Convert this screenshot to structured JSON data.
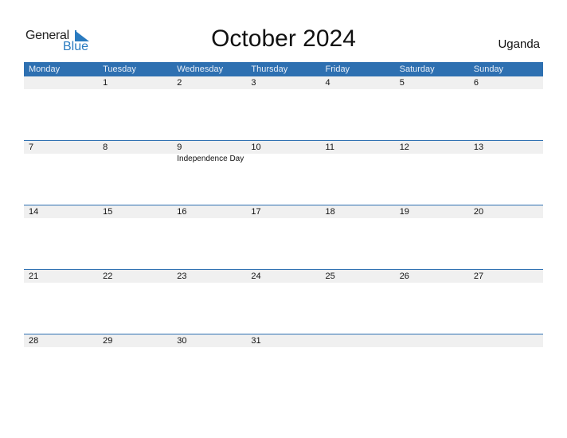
{
  "logo": {
    "word1": "General",
    "word2": "Blue"
  },
  "title": "October 2024",
  "country": "Uganda",
  "colors": {
    "accent": "#2e70b1",
    "strip": "#f0f0f0",
    "logo_blue": "#2a7bc0"
  },
  "weekdays": [
    "Monday",
    "Tuesday",
    "Wednesday",
    "Thursday",
    "Friday",
    "Saturday",
    "Sunday"
  ],
  "weeks": [
    [
      {
        "d": ""
      },
      {
        "d": "1"
      },
      {
        "d": "2"
      },
      {
        "d": "3"
      },
      {
        "d": "4"
      },
      {
        "d": "5"
      },
      {
        "d": "6"
      }
    ],
    [
      {
        "d": "7"
      },
      {
        "d": "8"
      },
      {
        "d": "9",
        "event": "Independence Day"
      },
      {
        "d": "10"
      },
      {
        "d": "11"
      },
      {
        "d": "12"
      },
      {
        "d": "13"
      }
    ],
    [
      {
        "d": "14"
      },
      {
        "d": "15"
      },
      {
        "d": "16"
      },
      {
        "d": "17"
      },
      {
        "d": "18"
      },
      {
        "d": "19"
      },
      {
        "d": "20"
      }
    ],
    [
      {
        "d": "21"
      },
      {
        "d": "22"
      },
      {
        "d": "23"
      },
      {
        "d": "24"
      },
      {
        "d": "25"
      },
      {
        "d": "26"
      },
      {
        "d": "27"
      }
    ],
    [
      {
        "d": "28"
      },
      {
        "d": "29"
      },
      {
        "d": "30"
      },
      {
        "d": "31"
      },
      {
        "d": ""
      },
      {
        "d": ""
      },
      {
        "d": ""
      }
    ]
  ]
}
